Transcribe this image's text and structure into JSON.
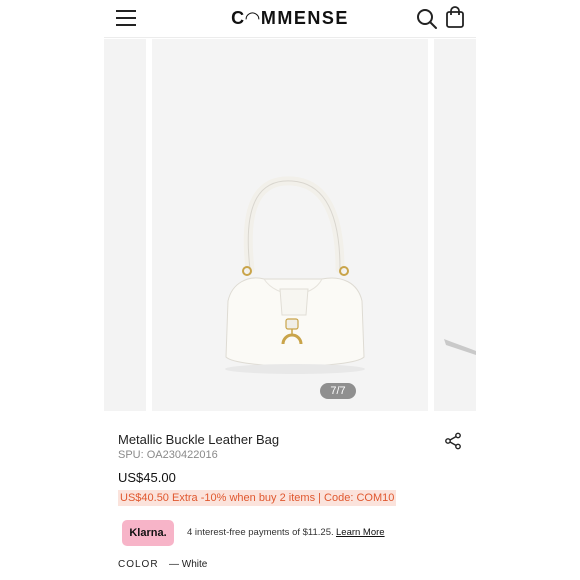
{
  "header": {
    "brand": "C◠MMENSE",
    "menu_icon": "hamburger-menu-icon",
    "search_icon": "search-icon",
    "bag_icon": "shopping-bag-icon"
  },
  "gallery": {
    "counter": "7/7",
    "current_index": 7,
    "total": 7
  },
  "product": {
    "title": "Metallic Buckle Leather Bag",
    "spu": "SPU: OA230422016",
    "price": "US$45.00",
    "promo_price": "US$40.50",
    "promo_text": "Extra -10% when buy 2 items | Code: COM10",
    "share_icon": "share-icon"
  },
  "klarna": {
    "badge": "Klarna.",
    "text": "4 interest-free payments of $11.25.",
    "link": "Learn More",
    "badge_color": "#f7b4c8"
  },
  "color": {
    "label": "COLOR",
    "value": "— White"
  },
  "colors": {
    "promo_bg": "#fbe3dc",
    "promo_text": "#e0582f"
  }
}
